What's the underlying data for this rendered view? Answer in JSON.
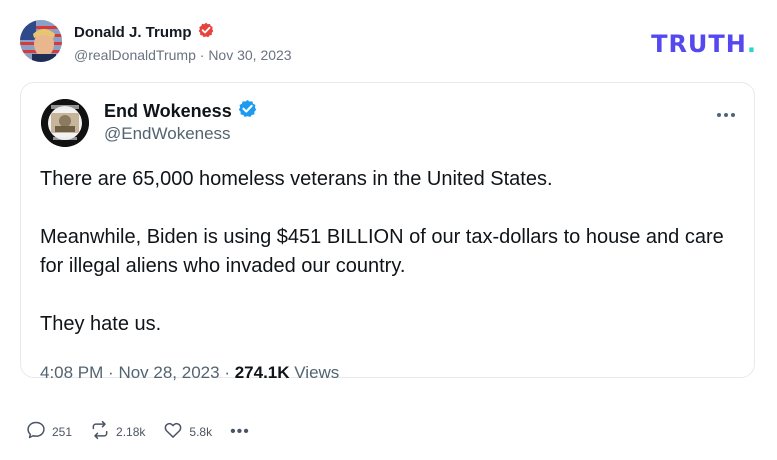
{
  "post": {
    "author_name": "Donald J. Trump",
    "handle": "@realDonaldTrump",
    "separator": "·",
    "date": "Nov 30, 2023",
    "platform_logo": "TRUTH",
    "platform_logo_dot": "."
  },
  "quoted": {
    "author_name": "End Wokeness",
    "handle": "@EndWokeness",
    "more_icon": "more-horizontal-icon",
    "paragraphs": [
      "There are 65,000 homeless veterans in the United States.",
      "Meanwhile, Biden is using $451 BILLION of our tax-dollars to house and care for illegal aliens who invaded our country.",
      "They hate us."
    ],
    "time": "4:08 PM",
    "date": "Nov 28, 2023",
    "views_count": "274.1K",
    "views_label": "Views"
  },
  "actions": {
    "replies": "251",
    "retruths": "2.18k",
    "likes": "5.8k",
    "more": "•••"
  },
  "colors": {
    "verified_red": "#e6433c",
    "verified_blue": "#1d9bf0",
    "truth_purple": "#5448ee",
    "truth_teal": "#28d7c0"
  }
}
